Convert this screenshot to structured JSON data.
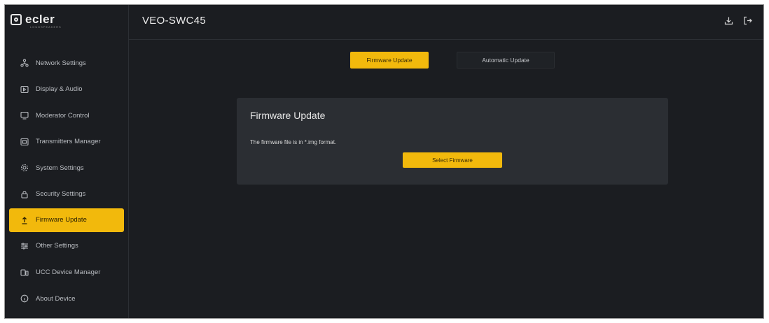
{
  "brand": {
    "name": "ecler",
    "sub": "LOUDSPEAKERS"
  },
  "header": {
    "title": "VEO-SWC45"
  },
  "sidebar": {
    "items": [
      {
        "label": "Network Settings",
        "icon": "network-icon"
      },
      {
        "label": "Display & Audio",
        "icon": "display-audio-icon"
      },
      {
        "label": "Moderator Control",
        "icon": "monitor-icon"
      },
      {
        "label": "Transmitters Manager",
        "icon": "transmitter-icon"
      },
      {
        "label": "System Settings",
        "icon": "gear-icon"
      },
      {
        "label": "Security Settings",
        "icon": "lock-icon"
      },
      {
        "label": "Firmware Update",
        "icon": "upload-icon"
      },
      {
        "label": "Other Settings",
        "icon": "sliders-icon"
      },
      {
        "label": "UCC Device Manager",
        "icon": "device-icon"
      },
      {
        "label": "About Device",
        "icon": "info-icon"
      }
    ],
    "active_index": 6
  },
  "tabs": [
    {
      "label": "Firmware Update"
    },
    {
      "label": "Automatic Update"
    }
  ],
  "card": {
    "title": "Firmware Update",
    "description": "The firmware file is in *.img format.",
    "button_label": "Select Firmware"
  },
  "colors": {
    "accent": "#f2b90c",
    "background": "#1b1d21",
    "card": "#2b2e33"
  }
}
